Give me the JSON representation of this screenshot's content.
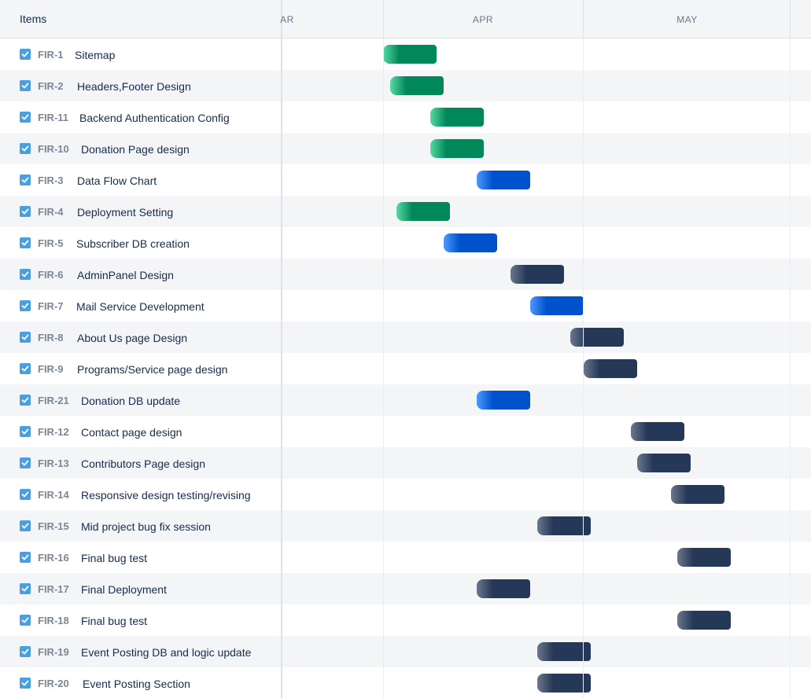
{
  "header": {
    "items_label": "Items",
    "months": [
      "AR",
      "APR",
      "MAY"
    ]
  },
  "colors": {
    "done": "#00875a",
    "in_progress": "#0052cc",
    "todo": "#253858",
    "checkbox": "#4a9fe0"
  },
  "rows": [
    {
      "key": "FIR-1",
      "summary": "Sitemap",
      "status": "done",
      "start": "Apr 1",
      "end": "Apr 8"
    },
    {
      "key": "FIR-2",
      "summary": "Headers,Footer Design",
      "status": "done",
      "start": "Apr 2",
      "end": "Apr 9"
    },
    {
      "key": "FIR-11",
      "summary": "Backend Authentication Config",
      "status": "done",
      "start": "Apr 8",
      "end": "Apr 15"
    },
    {
      "key": "FIR-10",
      "summary": "Donation Page design",
      "status": "done",
      "start": "Apr 8",
      "end": "Apr 15"
    },
    {
      "key": "FIR-3",
      "summary": "Data Flow Chart",
      "status": "inprogress",
      "start": "Apr 15",
      "end": "Apr 22"
    },
    {
      "key": "FIR-4",
      "summary": "Deployment Setting",
      "status": "done",
      "start": "Apr 3",
      "end": "Apr 10"
    },
    {
      "key": "FIR-5",
      "summary": "Subscriber DB creation",
      "status": "inprogress",
      "start": "Apr 10",
      "end": "Apr 17"
    },
    {
      "key": "FIR-6",
      "summary": "AdminPanel Design",
      "status": "todo",
      "start": "Apr 20",
      "end": "Apr 27"
    },
    {
      "key": "FIR-7",
      "summary": "Mail Service Development",
      "status": "inprogress",
      "start": "Apr 23",
      "end": "Apr 30"
    },
    {
      "key": "FIR-8",
      "summary": "About Us page Design",
      "status": "todo",
      "start": "Apr 29",
      "end": "May 6"
    },
    {
      "key": "FIR-9",
      "summary": "Programs/Service page design",
      "status": "todo",
      "start": "May 1",
      "end": "May 8"
    },
    {
      "key": "FIR-21",
      "summary": "Donation DB update",
      "status": "inprogress",
      "start": "Apr 15",
      "end": "Apr 22"
    },
    {
      "key": "FIR-12",
      "summary": "Contact page design",
      "status": "todo",
      "start": "May 8",
      "end": "May 15"
    },
    {
      "key": "FIR-13",
      "summary": "Contributors Page design",
      "status": "todo",
      "start": "May 9",
      "end": "May 16"
    },
    {
      "key": "FIR-14",
      "summary": "Responsive design testing/revising",
      "status": "todo",
      "start": "May 14",
      "end": "May 21"
    },
    {
      "key": "FIR-15",
      "summary": "Mid project bug fix session",
      "status": "todo",
      "start": "Apr 24",
      "end": "May 1"
    },
    {
      "key": "FIR-16",
      "summary": "Final bug test",
      "status": "todo",
      "start": "May 15",
      "end": "May 22"
    },
    {
      "key": "FIR-17",
      "summary": "Final Deployment",
      "status": "todo",
      "start": "Apr 15",
      "end": "Apr 22"
    },
    {
      "key": "FIR-18",
      "summary": "Final bug test",
      "status": "todo",
      "start": "May 15",
      "end": "May 22"
    },
    {
      "key": "FIR-19",
      "summary": "Event Posting DB and logic update",
      "status": "todo",
      "start": "Apr 24",
      "end": "May 1"
    },
    {
      "key": "FIR-20",
      "summary": "Event Posting Section",
      "status": "todo",
      "start": "Apr 24",
      "end": "May 1"
    }
  ]
}
